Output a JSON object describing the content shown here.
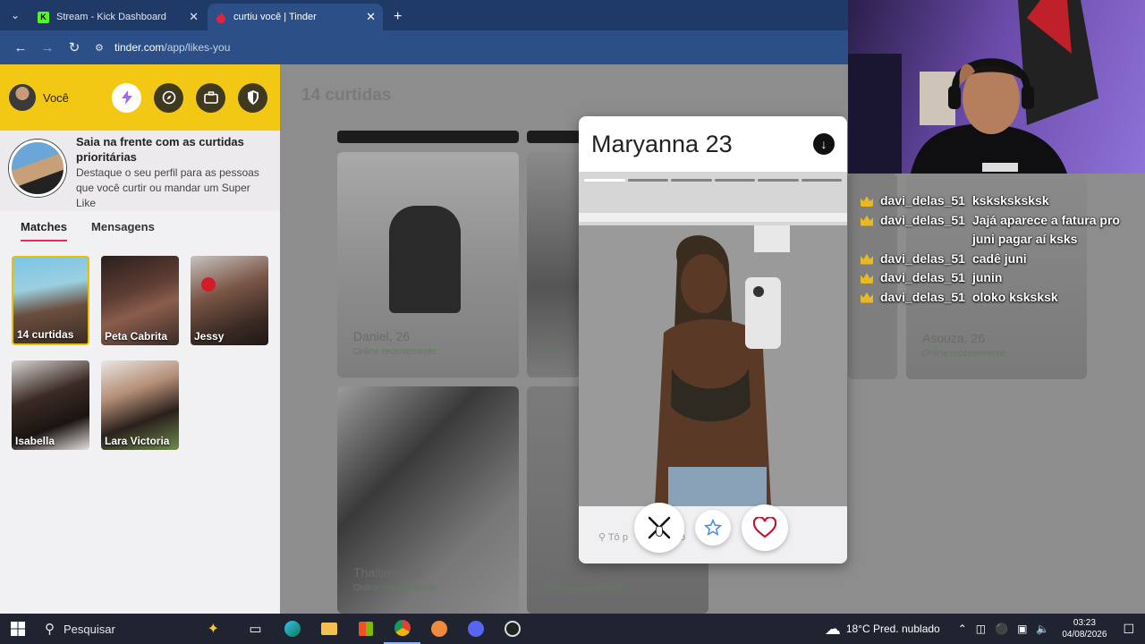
{
  "browser": {
    "tabs": [
      {
        "title": "Stream - Kick Dashboard",
        "favicon": "K",
        "active": false
      },
      {
        "title": "curtiu você | Tinder",
        "favicon": "flame",
        "active": true
      }
    ],
    "url_host": "tinder.com",
    "url_path": "/app/likes-you"
  },
  "sidebar": {
    "user_name": "Você",
    "header_buttons": [
      "boost-icon",
      "explore-icon",
      "briefcase-icon",
      "shield-icon"
    ],
    "promo_title": "Saia na frente com as curtidas prioritárias",
    "promo_desc": "Destaque o seu perfil para as pessoas que você curtir ou mandar um Super Like",
    "tabs": [
      "Matches",
      "Mensagens"
    ],
    "matches": [
      {
        "label": "14 curtidas"
      },
      {
        "label": "Peta Cabrita"
      },
      {
        "label": "Jessy"
      },
      {
        "label": "Isabella"
      },
      {
        "label": "Lara Victoria"
      }
    ]
  },
  "main": {
    "title": "14 curtidas",
    "cards": [
      {
        "name": "Daniel, 26",
        "status": "Online recentemente"
      },
      {
        "name": "Mike",
        "status": "Onli"
      },
      {
        "name": "Asouza, 26",
        "status": "Online recentemente"
      },
      {
        "name": "Thailane, 33",
        "status": "Online recentemente"
      },
      {
        "name": "Maryanna, 23",
        "status": "Online recentemente"
      }
    ]
  },
  "profile": {
    "name": "Maryanna",
    "age": "23",
    "message_placeholder": "Tô p",
    "message_placeholder_tail": "o",
    "photo_count": 6,
    "photo_index": 1
  },
  "chat": [
    {
      "user": "davi_delas_51",
      "msg": "ksksksksksk"
    },
    {
      "user": "davi_delas_51",
      "msg": "Jajá aparece a fatura pro juni pagar aí ksks"
    },
    {
      "user": "davi_delas_51",
      "msg": "cadê juni"
    },
    {
      "user": "davi_delas_51",
      "msg": "junin"
    },
    {
      "user": "davi_delas_51",
      "msg": "oloko ksksksk"
    }
  ],
  "taskbar": {
    "search_label": "Pesquisar",
    "weather": "18°C  Pred. nublado",
    "time": "03:23",
    "date": "04/08/2026"
  },
  "colors": {
    "tinder_yellow": "#f2c815",
    "tinder_pink": "#e22e5c",
    "like_red": "#c0172f",
    "superlike_blue": "#3d8ee6"
  }
}
